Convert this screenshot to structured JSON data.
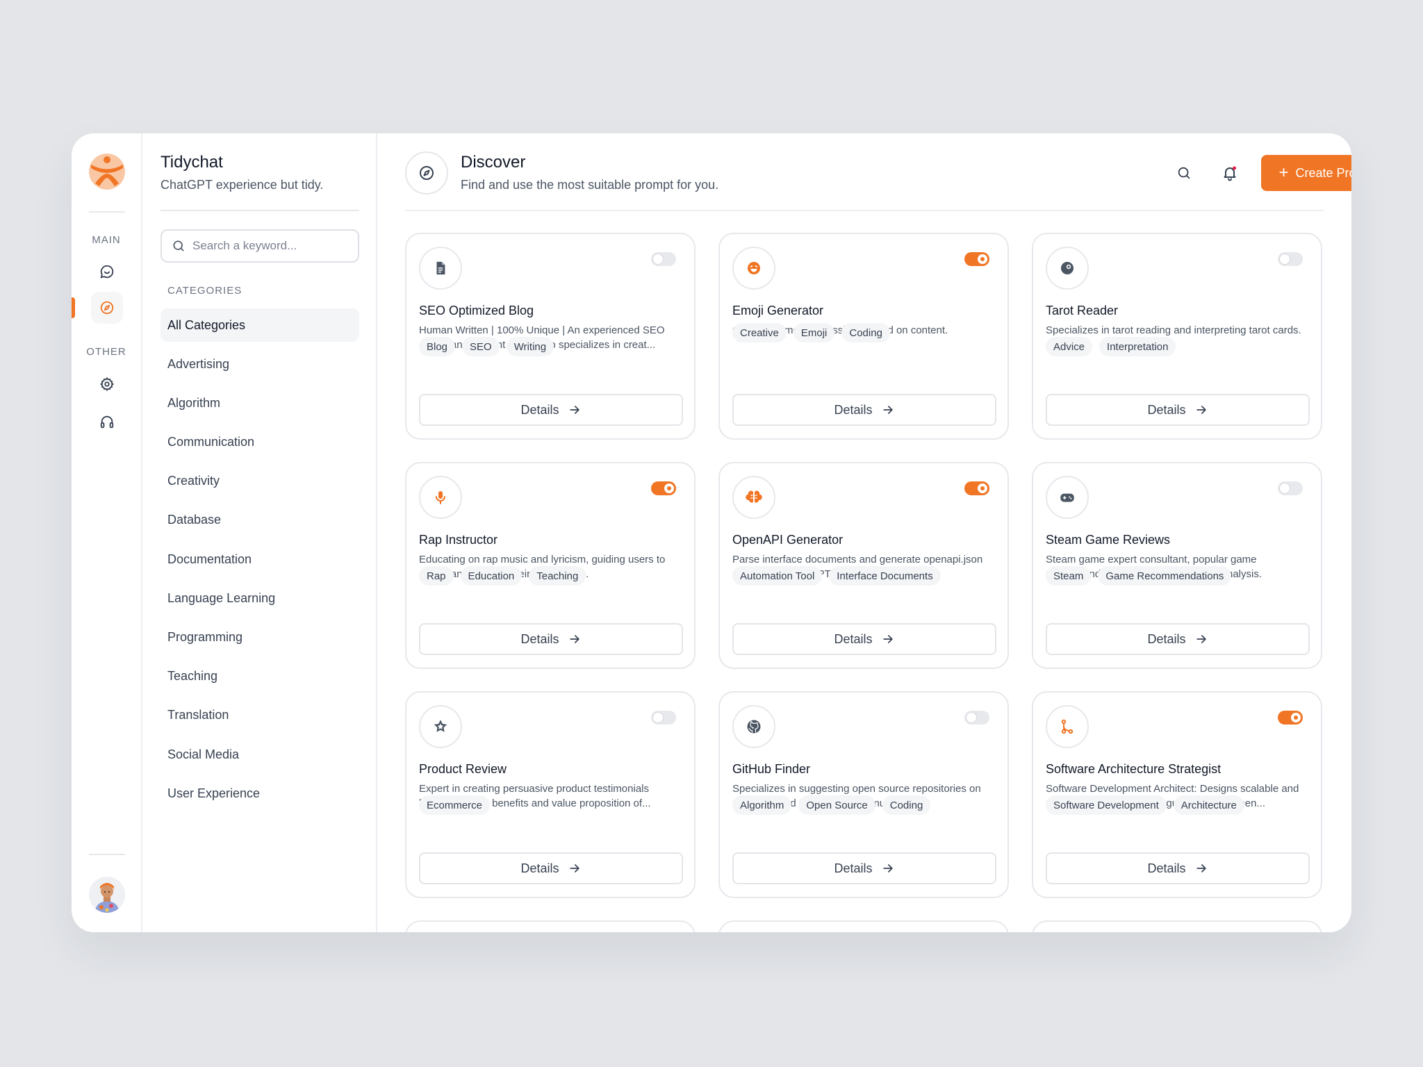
{
  "app": {
    "title": "Tidychat",
    "subtitle": "ChatGPT experience but tidy."
  },
  "rail": {
    "main_label": "MAIN",
    "other_label": "OTHER"
  },
  "search": {
    "placeholder": "Search a keyword..."
  },
  "categories": {
    "heading": "CATEGORIES",
    "items": [
      "All Categories",
      "Advertising",
      "Algorithm",
      "Communication",
      "Creativity",
      "Database",
      "Documentation",
      "Language Learning",
      "Programming",
      "Teaching",
      "Translation",
      "Social Media",
      "User Experience"
    ],
    "active_index": 0
  },
  "header": {
    "title": "Discover",
    "subtitle": "Find and use the most suitable prompt for you.",
    "create_label": "Create Prompt"
  },
  "colors": {
    "accent": "#f07524",
    "icon_dark": "#4b5563"
  },
  "details_label": "Details",
  "cards": [
    {
      "title": "SEO Optimized Blog",
      "desc": "Human Written | 100% Unique | An experienced SEO expert and content writer who specializes in creat...",
      "tags": [
        "Blog",
        "SEO",
        "Writing"
      ],
      "enabled": false,
      "icon": "document-icon"
    },
    {
      "title": "Emoji Generator",
      "desc": "Generate emoji expressions based on content.",
      "tags": [
        "Creative",
        "Emoji",
        "Coding"
      ],
      "enabled": true,
      "icon": "emoji-icon"
    },
    {
      "title": "Tarot Reader",
      "desc": "Specializes in tarot reading and interpreting tarot cards.",
      "tags": [
        "Advice",
        "Interpretation"
      ],
      "enabled": false,
      "icon": "crystal-ball-icon"
    },
    {
      "title": "Rap Instructor",
      "desc": "Educating on rap music and lyricism, guiding users to create and perform their own verses.",
      "tags": [
        "Rap",
        "Education",
        "Teaching"
      ],
      "enabled": true,
      "icon": "microphone-icon"
    },
    {
      "title": "OpenAPI Generator",
      "desc": "Parse interface documents and generate openapi.json required by ChatGPT Tool",
      "tags": [
        "Automation Tool",
        "Interface Documents"
      ],
      "enabled": true,
      "icon": "brain-icon"
    },
    {
      "title": "Steam Game Reviews",
      "desc": "Steam game expert consultant, popular game recommendations and in-depth game analysis.",
      "tags": [
        "Steam",
        "Game Recommendations"
      ],
      "enabled": false,
      "icon": "gamepad-icon"
    },
    {
      "title": "Product Review",
      "desc": "Expert in creating persuasive product testimonials highlighting the benefits and value proposition of...",
      "tags": [
        "Ecommerce"
      ],
      "enabled": false,
      "icon": "star-badge-icon"
    },
    {
      "title": "GitHub Finder",
      "desc": "Specializes in suggesting open source repositories on GitHub based on a custom formula.",
      "tags": [
        "Algorithm",
        "Open Source",
        "Coding"
      ],
      "enabled": false,
      "icon": "github-icon"
    },
    {
      "title": "Software Architecture Strategist",
      "desc": "Software Development Architect: Designs scalable and secure software systems, guides developmen...",
      "tags": [
        "Software Development",
        "Architecture"
      ],
      "enabled": true,
      "icon": "git-branch-icon"
    }
  ]
}
